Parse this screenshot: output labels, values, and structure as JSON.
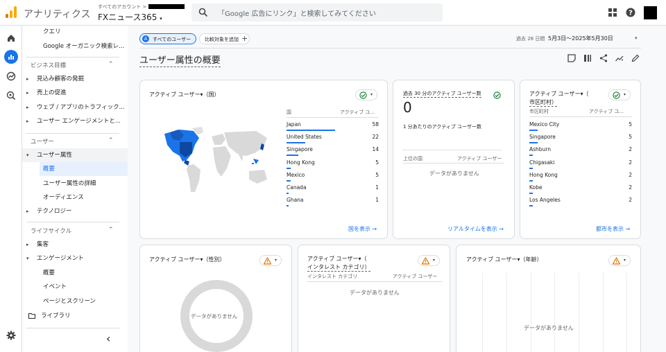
{
  "header": {
    "app_title": "アナリティクス",
    "account_crumb": "すべてのアカウント >",
    "property_name": "FXニュース365",
    "search_placeholder": "「Google 広告にリンク」と検索してみてください"
  },
  "sidebar": {
    "items_top": [
      {
        "label": "クエリ"
      },
      {
        "label": "Google オーガニック検索レ..."
      }
    ],
    "sections": [
      {
        "label": "ビジネス目標",
        "items": [
          {
            "label": "見込み顧客の発掘"
          },
          {
            "label": "売上の促進"
          },
          {
            "label": "ウェブ / アプリのトラフィック..."
          },
          {
            "label": "ユーザー エンゲージメントと..."
          }
        ]
      },
      {
        "label": "ユーザー",
        "items": [
          {
            "label": "ユーザー属性"
          },
          {
            "label": "概要"
          },
          {
            "label": "ユーザー属性の詳細"
          },
          {
            "label": "オーディエンス"
          },
          {
            "label": "テクノロジー"
          }
        ]
      },
      {
        "label": "ライフサイクル",
        "items": [
          {
            "label": "集客"
          },
          {
            "label": "エンゲージメント"
          },
          {
            "label": "概要"
          },
          {
            "label": "イベント"
          },
          {
            "label": "ページとスクリーン"
          }
        ]
      }
    ],
    "library_label": "ライブラリ",
    "collapse_glyph": "‹"
  },
  "main": {
    "chip_all_users": "すべてのユーザー",
    "chip_compare": "比較対象を追加",
    "date_prefix": "過去 28 日間",
    "date_range": "5月3日～2025年5月30日",
    "page_title": "ユーザー属性の概要",
    "country_card": {
      "title": "アクティブ ユーザー▾（国）",
      "col1": "国",
      "col2": "アクティブ ユ...",
      "rows": [
        {
          "label": "Japan",
          "value": "58",
          "share": 1.0
        },
        {
          "label": "United States",
          "value": "22",
          "share": 0.38
        },
        {
          "label": "Singapore",
          "value": "14",
          "share": 0.24
        },
        {
          "label": "Hong Kong",
          "value": "5",
          "share": 0.09
        },
        {
          "label": "Mexico",
          "value": "5",
          "share": 0.09
        },
        {
          "label": "Canada",
          "value": "1",
          "share": 0.02
        },
        {
          "label": "Ghana",
          "value": "1",
          "share": 0.02
        }
      ],
      "link": "国を表示 →"
    },
    "realtime_card": {
      "title": "過去 30 分のアクティブ ユーザー数",
      "value": "0",
      "subtitle": "1 分あたりのアクティブ ユーザー数",
      "col1": "上位の国",
      "col2": "アクティブ ユーザー",
      "nodata": "データがありません",
      "link": "リアルタイムを表示 →"
    },
    "city_card": {
      "title_line1": "アクティブ ユーザー▾（",
      "title_line2": "市区町村）",
      "col1": "市区町村",
      "col2": "アクティブ ユ...",
      "rows": [
        {
          "label": "Mexico City",
          "value": "5",
          "share": 1.0
        },
        {
          "label": "Singapore",
          "value": "5",
          "share": 1.0
        },
        {
          "label": "Ashburn",
          "value": "2",
          "share": 0.4
        },
        {
          "label": "Chigasaki",
          "value": "2",
          "share": 0.4
        },
        {
          "label": "Hong Kong",
          "value": "2",
          "share": 0.4
        },
        {
          "label": "Kobe",
          "value": "2",
          "share": 0.4
        },
        {
          "label": "Los Angeles",
          "value": "2",
          "share": 0.4
        }
      ],
      "link": "都市を表示 →"
    },
    "gender_card": {
      "title": "アクティブ ユーザー▾（性別）",
      "nodata": "データがありません"
    },
    "interest_card": {
      "title_line1": "アクティブ ユーザー▾（",
      "title_line2": "インタレスト カテゴリ）",
      "col1": "インタレスト カテゴリ",
      "col2": "アクティブ ユーザー",
      "nodata": "データがありません"
    },
    "age_card": {
      "title": "アクティブ ユーザー▾（年齢）",
      "nodata": "データがありません"
    }
  },
  "colors": {
    "accent": "#1a73e8",
    "success": "#188038",
    "warning": "#e37400",
    "logo_orange": "#f9ab00",
    "logo_dark_orange": "#e37400"
  }
}
